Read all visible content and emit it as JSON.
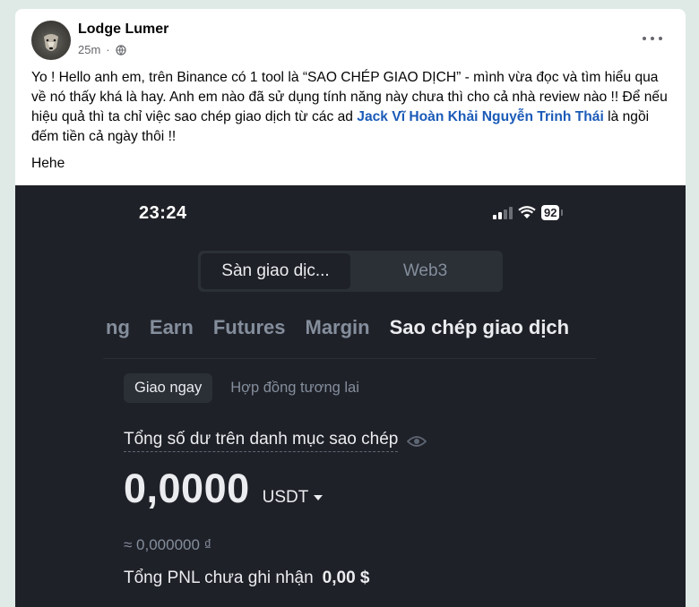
{
  "post": {
    "author": "Lodge Lumer",
    "time": "25m",
    "text_before": "Yo ! Hello anh em, trên Binance có 1 tool là “SAO CHÉP GIAO DỊCH” - mình vừa đọc và tìm hiểu qua về nó thấy khá là hay. Anh em nào đã sử dụng tính năng này chưa thì cho cả nhà review nào !! Để nếu hiệu quả thì ta chỉ việc sao chép giao dịch từ các ad ",
    "mention": "Jack Vĩ Hoàn Khải Nguyễn Trinh Thái",
    "text_after": " là ngồi đếm tiền cả ngày thôi !!",
    "extra": "Hehe"
  },
  "phone": {
    "time": "23:24",
    "battery": "92",
    "toggle": {
      "left": "Sàn giao dịc...",
      "right": "Web3"
    },
    "tabs": [
      "ng",
      "Earn",
      "Futures",
      "Margin",
      "Sao chép giao dịch"
    ],
    "subtabs": [
      "Giao ngay",
      "Hợp đồng tương lai"
    ],
    "balance_label": "Tổng số dư trên danh mục sao chép",
    "balance": "0,0000",
    "unit": "USDT",
    "approx": "≈ 0,000000 ₫",
    "pnl_label": "Tổng PNL chưa ghi nhận",
    "pnl_value": "0,00 $"
  },
  "colors": {
    "link": "#1b5bb8",
    "dark_bg": "#1f2128",
    "muted": "#848e9c"
  }
}
